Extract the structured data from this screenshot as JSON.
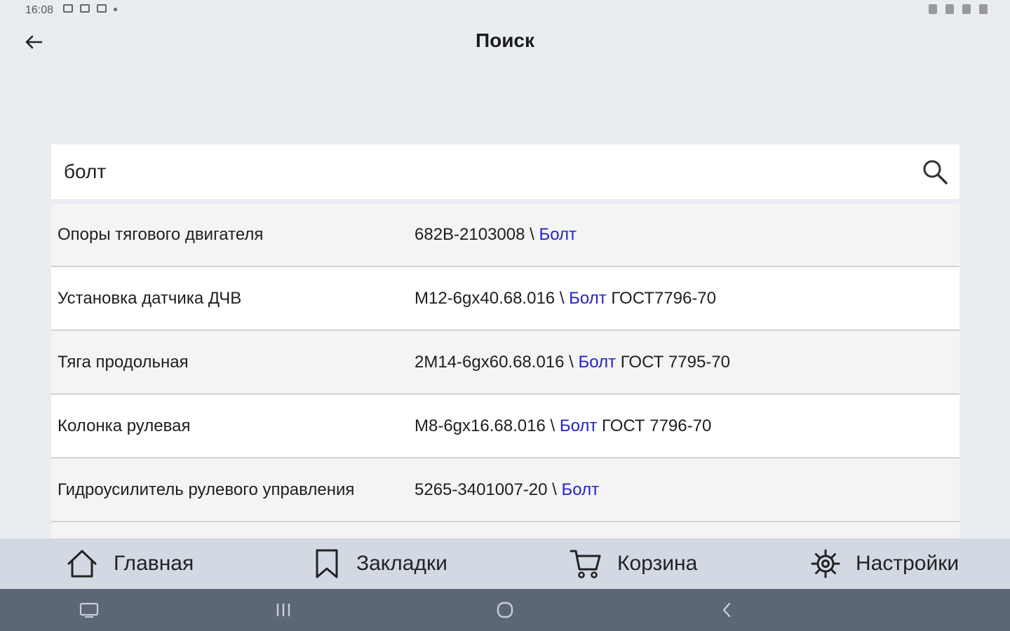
{
  "status_bar": {
    "time": "16:08"
  },
  "header": {
    "title": "Поиск"
  },
  "search": {
    "value": "болт"
  },
  "results": [
    {
      "name": "Опоры тягового двигателя",
      "part_prefix": "682В-2103008 \\ ",
      "part_highlight": "Болт",
      "part_suffix": ""
    },
    {
      "name": "Установка датчика ДЧВ",
      "part_prefix": "М12-6gх40.68.016 \\ ",
      "part_highlight": "Болт",
      "part_suffix": " ГОСТ7796-70"
    },
    {
      "name": "Тяга продольная",
      "part_prefix": "2М14-6gх60.68.016 \\ ",
      "part_highlight": "Болт",
      "part_suffix": " ГОСТ 7795-70"
    },
    {
      "name": "Колонка рулевая",
      "part_prefix": "М8-6gх16.68.016 \\ ",
      "part_highlight": "Болт",
      "part_suffix": " ГОСТ 7796-70"
    },
    {
      "name": "Гидроусилитель рулевого управления",
      "part_prefix": "5265-3401007-20 \\ ",
      "part_highlight": "Болт",
      "part_suffix": ""
    }
  ],
  "bottom_nav": {
    "home": "Главная",
    "bookmarks": "Закладки",
    "cart": "Корзина",
    "settings": "Настройки"
  },
  "colors": {
    "background": "#e9ecf1",
    "highlight": "#2424c8",
    "bottom_nav": "#d3d9e3",
    "system_nav": "#5c6675"
  }
}
